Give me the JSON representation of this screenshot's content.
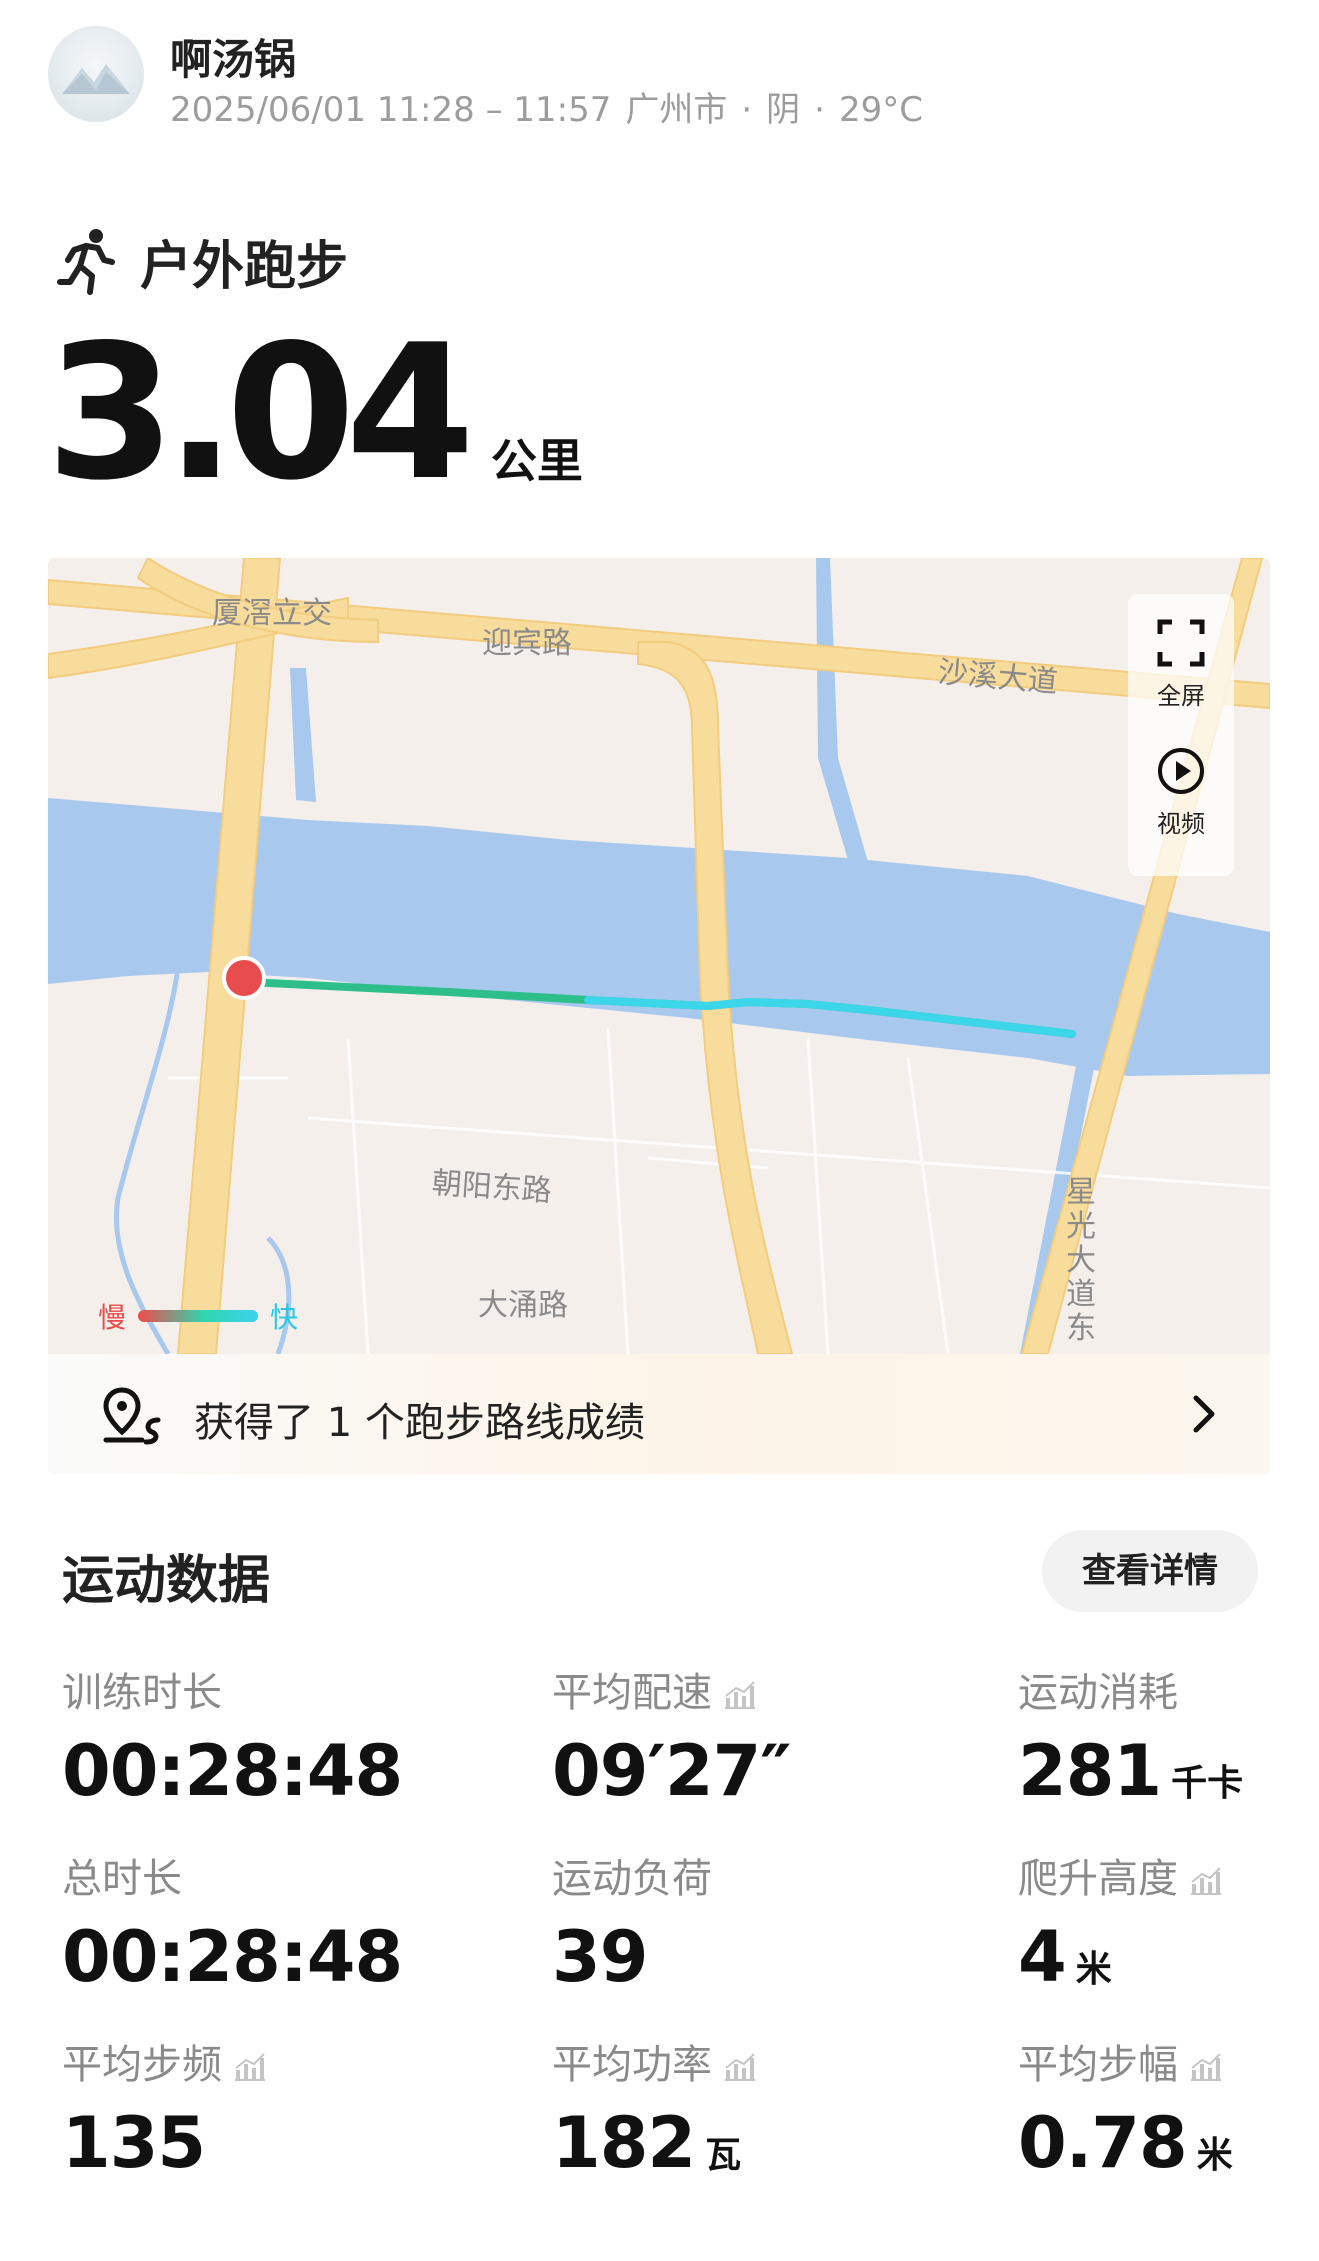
{
  "header": {
    "user_name": "啊汤锅",
    "datetime": "2025/06/01 11:28 – 11:57",
    "city": "广州市",
    "weather": "阴",
    "temperature": "29°C",
    "separator": "·"
  },
  "activity": {
    "type_label": "户外跑步",
    "distance_value": "3.04",
    "distance_unit": "公里"
  },
  "map": {
    "labels": {
      "interchange": "厦滘立交",
      "road_yingbin": "迎宾路",
      "road_shaxi": "沙溪大道",
      "road_chaoyang_east": "朝阳东路",
      "road_dayong": "大涌路",
      "road_xingguang": "星光大道东"
    },
    "fullscreen_label": "全屏",
    "video_label": "视频",
    "legend_slow": "慢",
    "legend_fast": "快",
    "colors": {
      "water": "#a8c8ee",
      "road": "#f8dc9c",
      "land": "#f5efec",
      "route_slow": "#2dbf8a",
      "route_fast": "#3cd6ea",
      "start_marker": "#e84c4c"
    }
  },
  "achievement": {
    "text": "获得了 1 个跑步路线成绩"
  },
  "sports_data": {
    "title": "运动数据",
    "detail_button": "查看详情",
    "stats": [
      {
        "label": "训练时长",
        "value": "00:28:48",
        "unit": "",
        "chart_icon": false
      },
      {
        "label": "平均配速",
        "value": "09′27″",
        "unit": "",
        "chart_icon": true
      },
      {
        "label": "运动消耗",
        "value": "281",
        "unit": "千卡",
        "chart_icon": false
      },
      {
        "label": "总时长",
        "value": "00:28:48",
        "unit": "",
        "chart_icon": false
      },
      {
        "label": "运动负荷",
        "value": "39",
        "unit": "",
        "chart_icon": false
      },
      {
        "label": "爬升高度",
        "value": "4",
        "unit": "米",
        "chart_icon": true
      },
      {
        "label": "平均步频",
        "value": "135",
        "unit": "",
        "chart_icon": true
      },
      {
        "label": "平均功率",
        "value": "182",
        "unit": "瓦",
        "chart_icon": true
      },
      {
        "label": "平均步幅",
        "value": "0.78",
        "unit": "米",
        "chart_icon": true
      }
    ]
  }
}
